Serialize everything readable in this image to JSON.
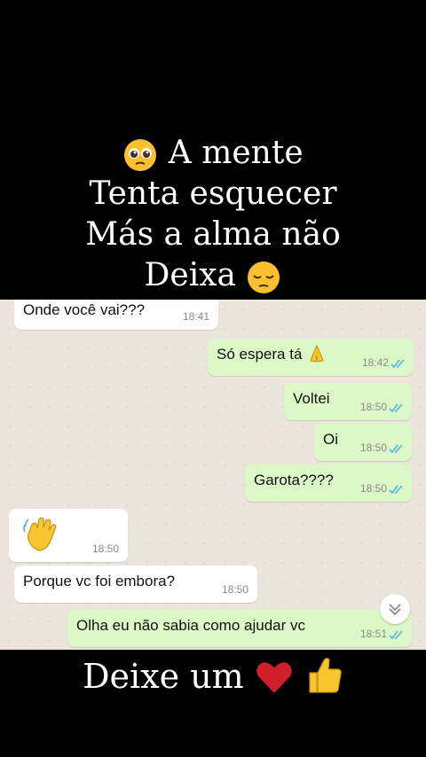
{
  "top_caption": {
    "line1": "A mente",
    "line2": "Tenta esquecer",
    "line3": "Más a alma não",
    "line4": "Deixa"
  },
  "bottom_caption": {
    "text": "Deixe um"
  },
  "messages": [
    {
      "direction": "in",
      "text": "Onde você vai???",
      "time": "18:41"
    },
    {
      "direction": "out",
      "text": "Só espera tá",
      "time": "18:42",
      "emoji": "folded-hands-icon"
    },
    {
      "direction": "out",
      "text": "Voltei",
      "time": "18:50"
    },
    {
      "direction": "out",
      "text": "Oi",
      "time": "18:50"
    },
    {
      "direction": "out",
      "text": "Garota????",
      "time": "18:50"
    },
    {
      "direction": "in",
      "text": "",
      "time": "18:50",
      "emoji": "waving-hand-icon"
    },
    {
      "direction": "in",
      "text": "Porque vc foi embora?",
      "time": "18:50"
    },
    {
      "direction": "out",
      "text": "Olha eu não sabia como ajudar vc",
      "time": "18:51"
    }
  ],
  "colors": {
    "incoming_bubble": "#ffffff",
    "outgoing_bubble": "#dcf8c6",
    "read_ticks": "#4fb6ec",
    "chat_background": "#ece5dd",
    "heart": "#d11f2a",
    "thumbs_up": "#f7c52d"
  },
  "icons": [
    "pleading-face-icon",
    "pensive-face-icon",
    "folded-hands-icon",
    "waving-hand-icon",
    "double-check-icon",
    "scroll-down-icon",
    "red-heart-icon",
    "thumbs-up-icon"
  ]
}
